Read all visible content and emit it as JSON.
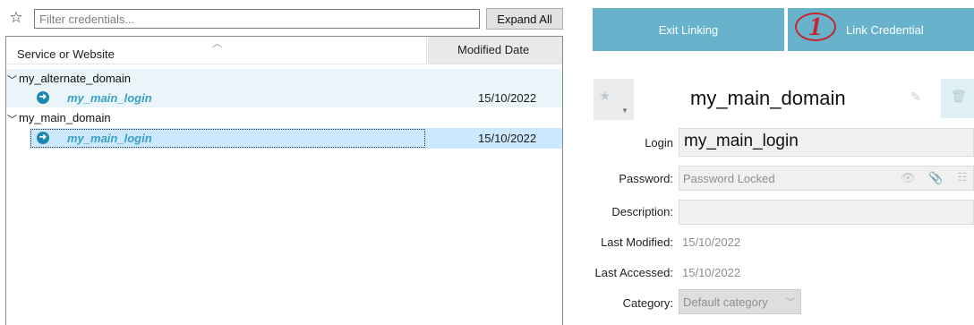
{
  "filter": {
    "placeholder": "Filter credentials...",
    "expand_all_label": "Expand All"
  },
  "table": {
    "columns": {
      "service": "Service or Website",
      "modified": "Modified Date"
    },
    "groups": [
      {
        "name": "my_alternate_domain",
        "items": [
          {
            "login": "my_main_login",
            "modified": "15/10/2022"
          }
        ]
      },
      {
        "name": "my_main_domain",
        "items": [
          {
            "login": "my_main_login",
            "modified": "15/10/2022"
          }
        ]
      }
    ]
  },
  "actions": {
    "exit_linking": "Exit Linking",
    "link_credential": "Link Credential",
    "step_badge": "1"
  },
  "detail": {
    "title": "my_main_domain",
    "login_label": "Login",
    "login_value": "my_main_login",
    "password_label": "Password:",
    "password_value": "Password Locked",
    "description_label": "Description:",
    "description_value": "",
    "last_modified_label": "Last Modified:",
    "last_modified_value": "15/10/2022",
    "last_accessed_label": "Last Accessed:",
    "last_accessed_value": "15/10/2022",
    "category_label": "Category:",
    "category_value": "Default category"
  },
  "icons": {
    "filter_star": "star-outline-icon",
    "favorite": "star-icon",
    "edit": "edit-icon",
    "delete": "trash-icon",
    "reveal_password": "eye-icon",
    "copy_password": "paperclip-icon",
    "password_options": "sliders-icon",
    "login_entry": "arrow-right-circle-icon",
    "expand_group": "chevron-down-icon"
  },
  "colors": {
    "accent": "#68b3cb",
    "link_text": "#3aa0c6",
    "selection": "#cce8ff",
    "badge": "#c6262b"
  }
}
